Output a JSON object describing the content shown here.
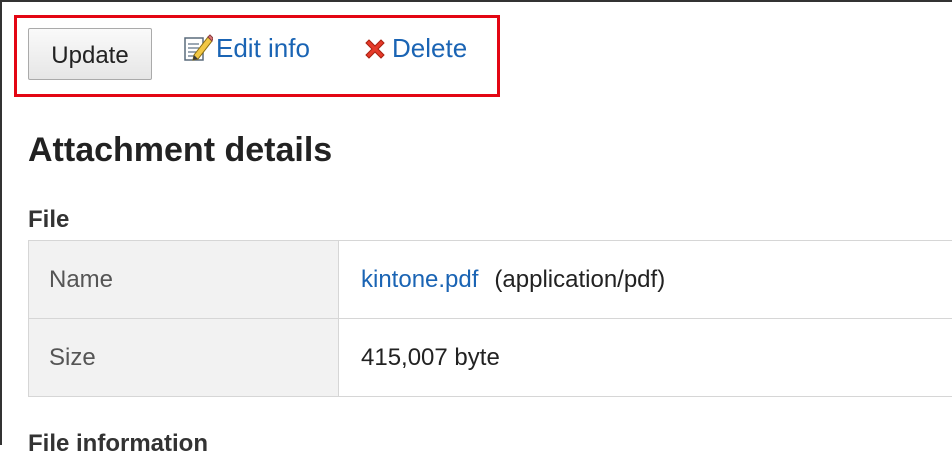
{
  "toolbar": {
    "update_label": "Update",
    "edit_label": "Edit info",
    "delete_label": "Delete"
  },
  "page": {
    "title": "Attachment details"
  },
  "file_section": {
    "title": "File",
    "rows": [
      {
        "label": "Name",
        "file_name": "kintone.pdf",
        "mime": "(application/pdf)"
      },
      {
        "label": "Size",
        "value": "415,007 byte"
      }
    ]
  },
  "next_section": {
    "title": "File information"
  },
  "colors": {
    "highlight": "#e30613",
    "link": "#1a64b4"
  },
  "icons": {
    "edit": "edit-icon",
    "delete": "delete-icon"
  }
}
